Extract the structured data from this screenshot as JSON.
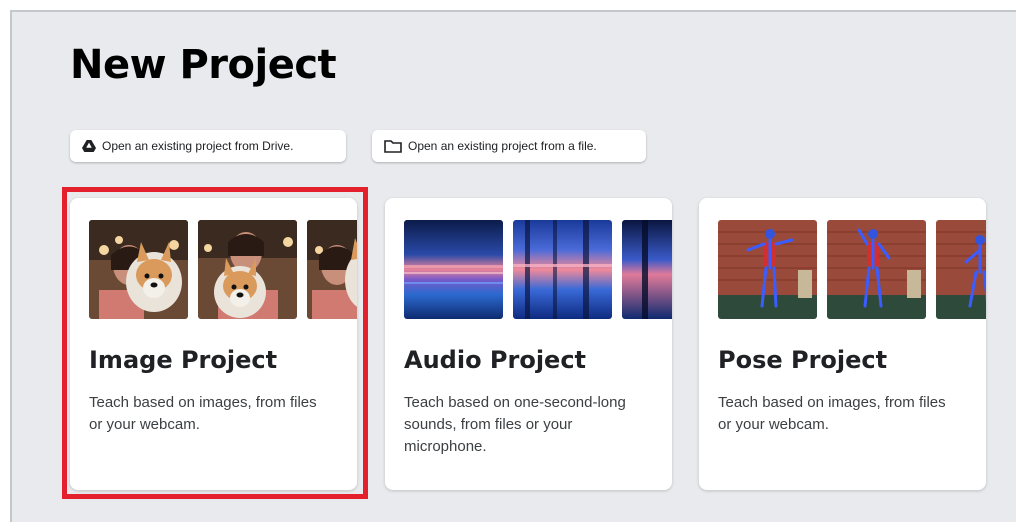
{
  "page": {
    "title": "New Project"
  },
  "open_actions": {
    "drive_label": "Open an existing project from Drive.",
    "file_label": "Open an existing project from a file."
  },
  "icons": {
    "drive": "google-drive-icon",
    "file": "folder-icon"
  },
  "highlight_color": "#e3202b",
  "cards": [
    {
      "title": "Image Project",
      "description": "Teach based on images, from files or your webcam.",
      "thumbnails": "photos-of-person-with-plush-dog",
      "selected": true
    },
    {
      "title": "Audio Project",
      "description": "Teach based on one-second-long sounds, from files or your microphone.",
      "thumbnails": "audio-spectrograms",
      "selected": false
    },
    {
      "title": "Pose Project",
      "description": "Teach based on images, from files or your webcam.",
      "thumbnails": "person-with-pose-skeleton-overlay",
      "selected": false
    }
  ]
}
